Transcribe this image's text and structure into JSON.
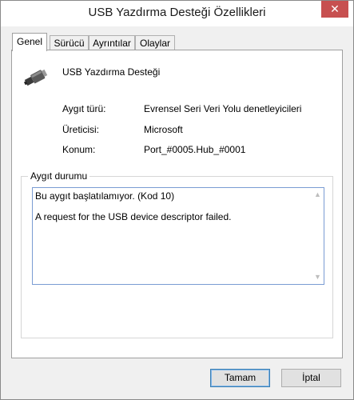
{
  "window": {
    "title": "USB Yazdırma Desteği Özellikleri",
    "close_glyph": "✕"
  },
  "tabs": [
    {
      "label": "Genel",
      "active": true
    },
    {
      "label": "Sürücü",
      "active": false
    },
    {
      "label": "Ayrıntılar",
      "active": false
    },
    {
      "label": "Olaylar",
      "active": false
    }
  ],
  "device": {
    "icon": "usb-plug-icon",
    "name": "USB Yazdırma Desteği"
  },
  "properties": [
    {
      "label": "Aygıt türü:",
      "value": "Evrensel Seri Veri Yolu denetleyicileri"
    },
    {
      "label": "Üreticisi:",
      "value": "Microsoft"
    },
    {
      "label": "Konum:",
      "value": "Port_#0005.Hub_#0001"
    }
  ],
  "status": {
    "legend": "Aygıt durumu",
    "lines": [
      "Bu aygıt başlatılamıyor. (Kod 10)",
      "A request for the USB device descriptor failed."
    ]
  },
  "buttons": {
    "ok": "Tamam",
    "cancel": "İptal"
  }
}
